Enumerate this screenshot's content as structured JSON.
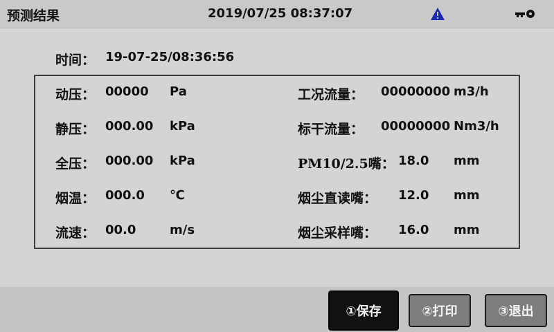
{
  "header": {
    "title": "预测结果",
    "datetime": "2019/07/25 08:37:07",
    "alert_icon": "warning-triangle-icon",
    "alert_color": "#1a2ab0",
    "key_icon": "key-icon"
  },
  "time": {
    "label": "时间：",
    "value": "19-07-25/08:36:56"
  },
  "left_rows": [
    {
      "label": "动压：",
      "value": "00000",
      "unit": "Pa"
    },
    {
      "label": "静压：",
      "value": "000.00",
      "unit": "kPa"
    },
    {
      "label": "全压：",
      "value": "000.00",
      "unit": "kPa"
    },
    {
      "label": "烟温：",
      "value": "000.0",
      "unit": "℃"
    },
    {
      "label": "流速：",
      "value": "00.0",
      "unit": "m/s"
    }
  ],
  "right_rows": [
    {
      "label": "工况流量：",
      "value": "00000000",
      "unit": "m3/h"
    },
    {
      "label": "标干流量：",
      "value": "00000000",
      "unit": "Nm3/h"
    },
    {
      "label": "PM10/2.5嘴：",
      "value": "18.0",
      "unit": "mm"
    },
    {
      "label": "烟尘直读嘴：",
      "value": "12.0",
      "unit": "mm"
    },
    {
      "label": "烟尘采样嘴：",
      "value": "16.0",
      "unit": "mm"
    }
  ],
  "buttons": {
    "save": "①保存",
    "print": "②打印",
    "exit": "③退出"
  }
}
